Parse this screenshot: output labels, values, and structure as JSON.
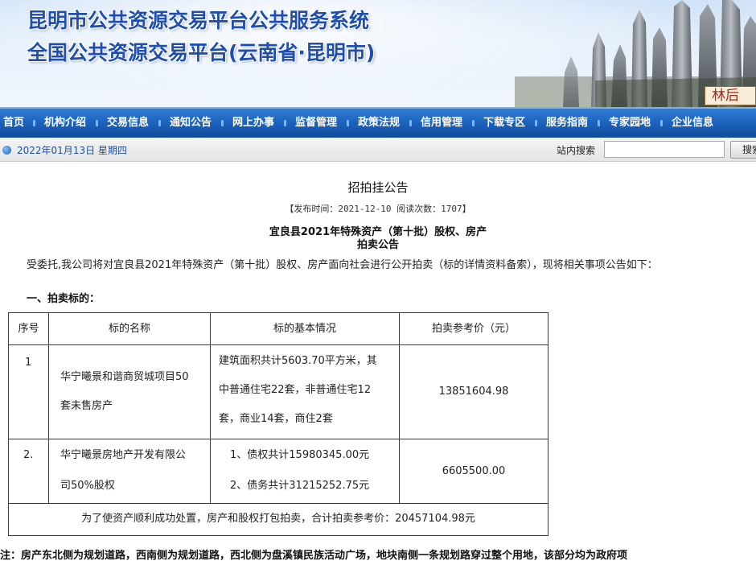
{
  "banner": {
    "title_line1": "昆明市公共资源交易平台公共服务系统",
    "title_line2": "全国公共资源交易平台(云南省·昆明市)",
    "stamp_text": "林后"
  },
  "nav": {
    "items": [
      {
        "label": "首页"
      },
      {
        "label": "机构介绍"
      },
      {
        "label": "交易信息"
      },
      {
        "label": "通知公告"
      },
      {
        "label": "网上办事"
      },
      {
        "label": "监督管理"
      },
      {
        "label": "政策法规"
      },
      {
        "label": "信用管理"
      },
      {
        "label": "下载专区"
      },
      {
        "label": "服务指南"
      },
      {
        "label": "专家园地"
      },
      {
        "label": "企业信息"
      }
    ]
  },
  "datebar": {
    "date": "2022年01月13日  星期四",
    "search_label": "站内搜索",
    "search_value": "",
    "search_button": "搜索"
  },
  "article": {
    "title": "招拍挂公告",
    "meta": "【发布时间：2021-12-10  阅读次数：1707】",
    "subtitle_line1": "宜良县2021年特殊资产（第十批）股权、房产",
    "subtitle_line2": "拍卖公告",
    "intro": "受委托,我公司将对宜良县2021年特殊资产（第十批）股权、房产面向社会进行公开拍卖（标的详情资料备索），现将相关事项公告如下：",
    "section1": "一、拍卖标的："
  },
  "table": {
    "headers": [
      "序号",
      "标的名称",
      "标的基本情况",
      "拍卖参考价（元）"
    ],
    "rows": [
      {
        "no": "1",
        "name_lines": [
          "华宁曦景和谐商贸城项目50",
          "套未售房产"
        ],
        "info_lines": [
          "建筑面积共计5603.70平方米，其",
          "中普通住宅22套，非普通住宅12",
          "套，商业14套，商住2套"
        ],
        "price": "13851604.98"
      },
      {
        "no": "2.",
        "name_lines": [
          "华宁曦景房地产开发有限公",
          "司50%股权"
        ],
        "info_lines": [
          "1、债权共计15980345.00元",
          "2、债务共计31215252.75元"
        ],
        "price": "6605500.00"
      }
    ],
    "footer": "为了使资产顺利成功处置，房产和股权打包拍卖，合计拍卖参考价：20457104.98元"
  },
  "note": "注：房产东北侧为规划道路，西南侧为规划道路，西北侧为盘溪镇民族活动广场，地块南侧一条规划路穿过整个用地，该部分均为政府项"
}
